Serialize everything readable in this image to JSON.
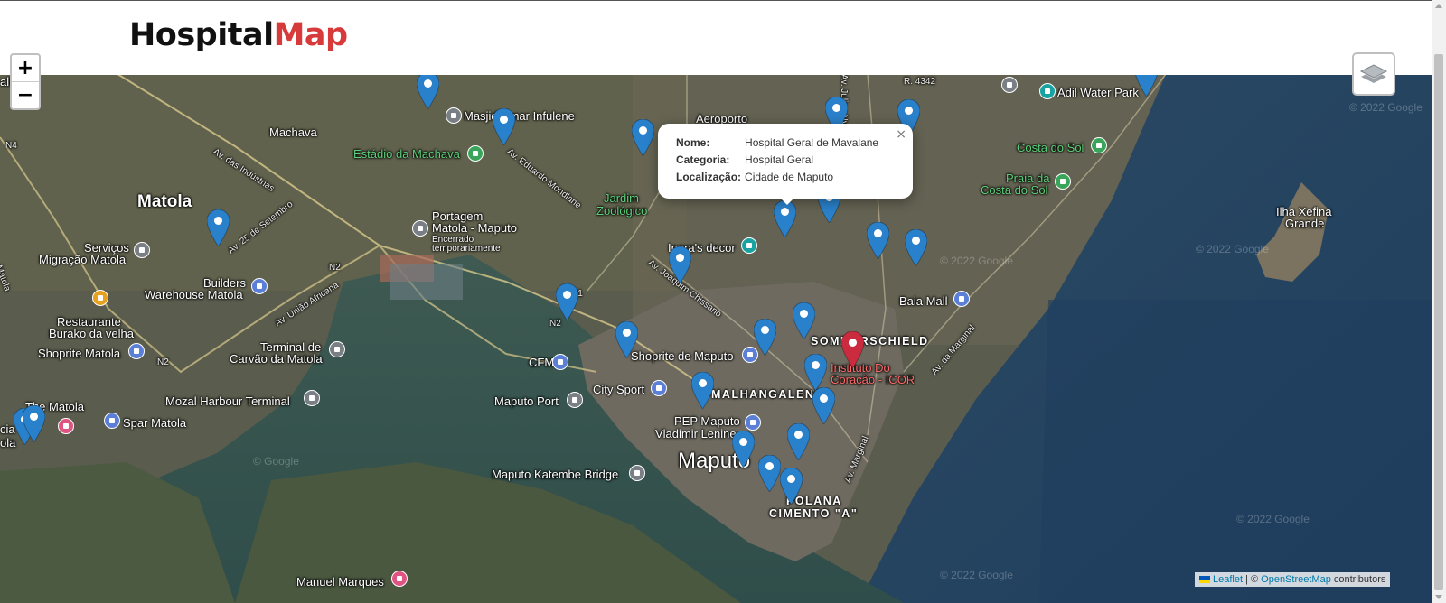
{
  "header": {
    "logo_primary": "Hospital",
    "logo_accent": "Map"
  },
  "zoom": {
    "in_label": "+",
    "out_label": "−"
  },
  "popup": {
    "close_label": "×",
    "rows": [
      {
        "key": "Nome:",
        "value": "Hospital Geral de Mavalane"
      },
      {
        "key": "Categoria:",
        "value": "Hospital Geral"
      },
      {
        "key": "Localização:",
        "value": "Cidade de Maputo"
      }
    ]
  },
  "attribution": {
    "leaflet": "Leaflet",
    "separator": " | © ",
    "osm": "OpenStreetMap",
    "suffix": " contributors"
  },
  "map_labels": {
    "machava": "Machava",
    "masjid": "Masjid Umar Infulene",
    "estadio": "Estádio da Machava",
    "aeroporto": "Aeroporto",
    "matola": "Matola",
    "portagem": "Portagem",
    "portagem2": "Matola - Maputo",
    "encerrado": "Encerrado",
    "temporariamente": "temporariamente",
    "jardim": "Jardim",
    "zoologico": "Zoológico",
    "ingras": "Ingra's decor",
    "servicos": "Serviços",
    "migracao": "Migração Matola",
    "builders": "Builders",
    "warehouse": "Warehouse Matola",
    "restaurante": "Restaurante",
    "buraka": "Burako da velha",
    "shoprite_matola": "Shoprite Matola",
    "terminal": "Terminal de",
    "carvao": "Carvão da Matola",
    "mozal": "Mozal Harbour Terminal",
    "the_matola": "The Matola",
    "spar": "Spar Matola",
    "cia": "cia",
    "ola": "ola",
    "cfm": "CFM",
    "shoprite_maputo": "Shoprite de Maputo",
    "maputo_port": "Maputo Port",
    "city_sport": "City Sport",
    "malhangalene": "MALHANGALENE",
    "pep": "PEP Maputo",
    "vladimir": "Vladimir Lenine",
    "maputo": "Maputo",
    "katembe": "Maputo Katembe Bridge",
    "polana": "POLANA",
    "cimento": "CIMENTO \"A\"",
    "manuel": "Manuel Marques",
    "sommerschield": "SOMMERSCHIELD",
    "instituto": "Instituto Do",
    "coracao": "Coração - ICOR",
    "baia": "Baia Mall",
    "adil": "Adil Water Park",
    "costa_sol": "Costa do Sol",
    "praia": "Praia da",
    "costa_sol2": "Costa do Sol",
    "ilha": "Ilha Xefina",
    "grande": "Grande",
    "all": "all",
    "google1": "© 2022 Google",
    "google2": "© 2022 Google",
    "google3": "© 2022 Google",
    "google4": "© 2022 Google",
    "google5": "© 2022 Google",
    "google6": "© Google",
    "road_industrias": "Av. das Indústrias",
    "road_mondlane": "Av. Eduardo Mondlane",
    "road_setembro": "Av. 25 de Setembro",
    "road_uniao": "Av. União Africana",
    "road_chissano": "Av. Joaquim Chissano",
    "road_marginal": "Av. da Marginal",
    "road_marginal2": "Av. Marginal",
    "road_julius": "Av. Julius Nyerere",
    "road_r4342": "R. 4342",
    "road_n4": "N4",
    "road_n2": "N2",
    "road_n2b": "N2",
    "road_n1": "N1",
    "road_n2c": "N2",
    "road_matola": "Matola"
  },
  "colors": {
    "accent": "#d63a3a",
    "marker_blue": "#2a81cb",
    "marker_red": "#cb2b3e"
  }
}
